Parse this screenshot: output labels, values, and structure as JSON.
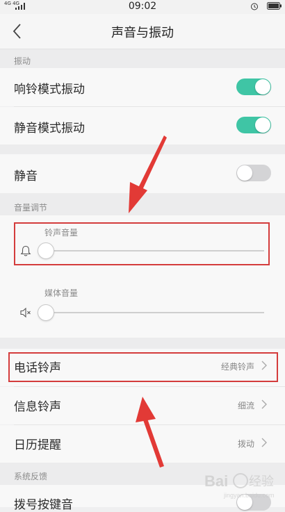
{
  "status_bar": {
    "network": "4G 4G",
    "time": "09:02"
  },
  "header": {
    "title": "声音与振动"
  },
  "sections": {
    "vibration": "振动",
    "volume": "音量调节",
    "feedback": "系统反馈"
  },
  "rows": {
    "ring_vibrate": {
      "label": "响铃模式振动",
      "on": true
    },
    "silent_vibrate": {
      "label": "静音模式振动",
      "on": true
    },
    "mute": {
      "label": "静音",
      "on": false
    },
    "ringtone": {
      "label": "电话铃声",
      "value": "经典铃声"
    },
    "message_tone": {
      "label": "信息铃声",
      "value": "细流"
    },
    "calendar": {
      "label": "日历提醒",
      "value": "拨动"
    },
    "dial_tone": {
      "label": "拨号按键音"
    }
  },
  "volume": {
    "ringtone": {
      "label": "铃声音量",
      "level": 0
    },
    "media": {
      "label": "媒体音量",
      "level": 0
    }
  },
  "colors": {
    "accent_toggle": "#3fc5a5",
    "annotation_red": "#d43c3c"
  },
  "watermark": {
    "text": "Bai 经验",
    "url": "jingyan.baidu.com"
  }
}
